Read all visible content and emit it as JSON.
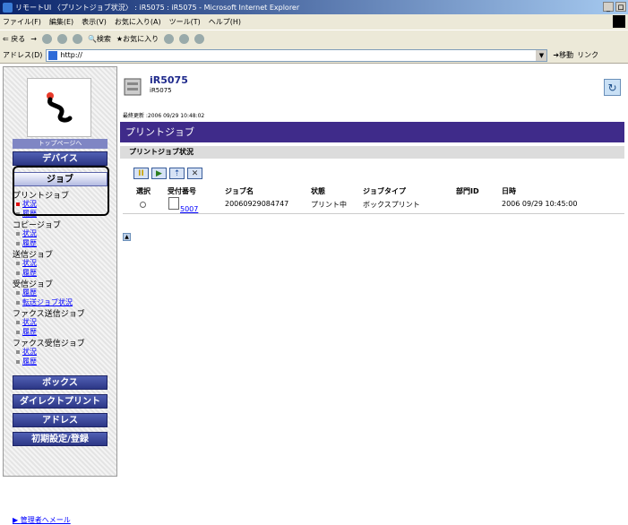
{
  "window": {
    "title": "リモートUI 〈プリントジョブ状況〉 : iR5075 : iR5075 - Microsoft Internet Explorer",
    "controls": [
      "_",
      "ロ"
    ]
  },
  "menu": [
    "ファイル(F)",
    "編集(E)",
    "表示(V)",
    "お気に入り(A)",
    "ツール(T)",
    "ヘルプ(H)"
  ],
  "toolbar": {
    "back": "戻る",
    "search": "検索",
    "favorites": "お気に入り"
  },
  "address": {
    "label": "アドレス(D)",
    "value": "http://",
    "go": "移動",
    "links": "リンク"
  },
  "sidebar": {
    "home_label": "トップページへ",
    "device": "デバイス",
    "job": "ジョブ",
    "print_job": "プリントジョブ",
    "status": "状況",
    "history": "履歴",
    "copy_job": "コピージョブ",
    "send_job": "送信ジョブ",
    "receive_job": "受信ジョブ",
    "forward_status": "転送ジョブ状況",
    "fax_send_job": "ファクス送信ジョブ",
    "fax_receive_job": "ファクス受信ジョブ",
    "box": "ボックス",
    "direct_print": "ダイレクトプリント",
    "address": "アドレス",
    "settings": "初期設定/登録",
    "admin_mail": "管理者へメール"
  },
  "content": {
    "device_name": "iR5075",
    "device_sub": "iR5075",
    "last_updated": "最終更新 :2006 09/29 10:48:02",
    "banner": "プリントジョブ",
    "subheader": "プリントジョブ状況",
    "columns": [
      "選択",
      "受付番号",
      "ジョブ名",
      "状態",
      "ジョブタイプ",
      "部門ID",
      "日時"
    ],
    "row": {
      "number": "5007",
      "name": "20060929084747",
      "status": "プリント中",
      "type": "ボックスプリント",
      "dept": "",
      "datetime": "2006 09/29 10:45:00"
    }
  }
}
